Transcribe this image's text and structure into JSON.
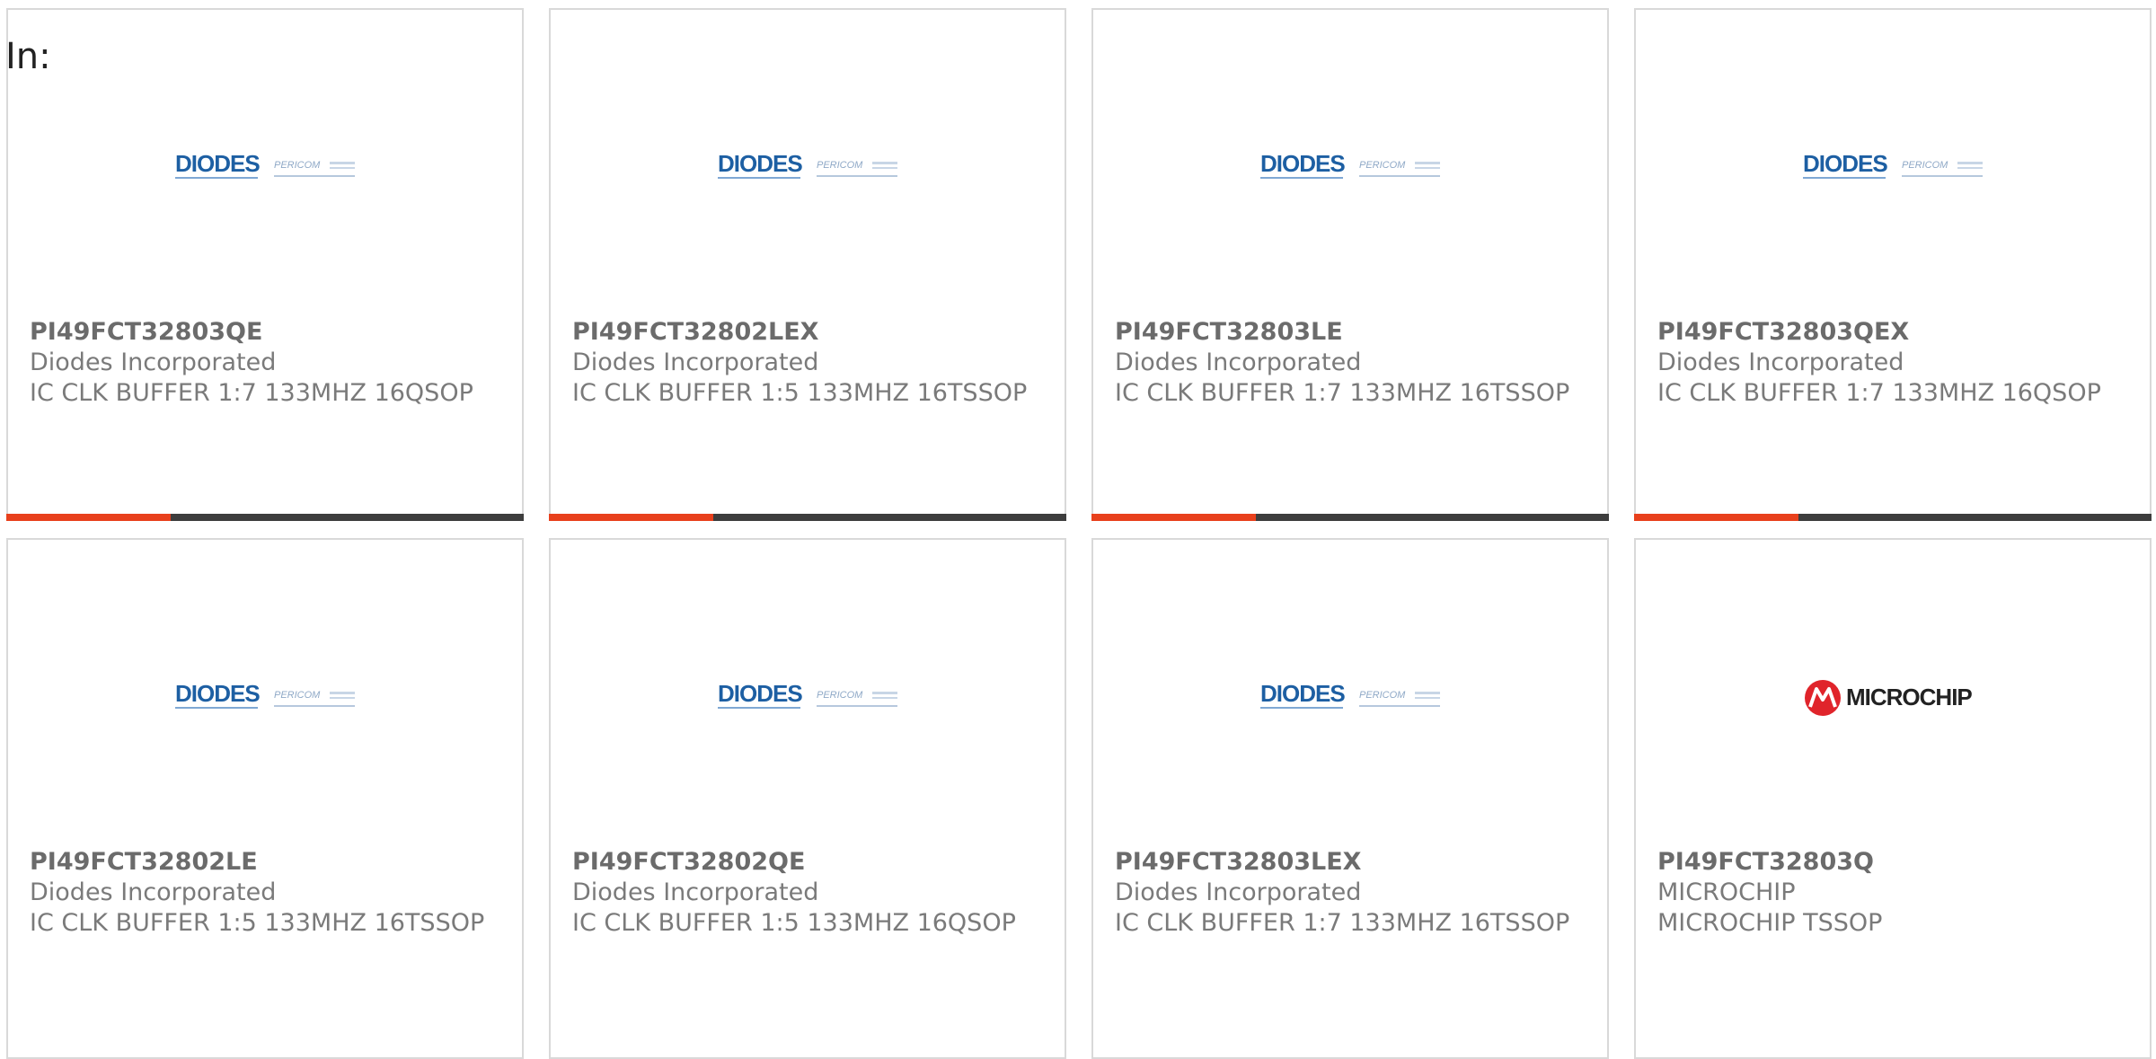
{
  "filter": {
    "label": "In:"
  },
  "colors": {
    "accent_orange": "#e8401c",
    "accent_dark": "#3d3d3d",
    "diodes_blue": "#1d5fa3",
    "microchip_red": "#e0242b"
  },
  "products": [
    {
      "part": "PI49FCT32803QE",
      "maker": "Diodes Incorporated",
      "desc": "IC CLK BUFFER 1:7 133MHZ 16QSOP",
      "logo": "diodes-pericom-logo",
      "logo_text": "DIODES",
      "logo_sub": "PERICOM"
    },
    {
      "part": "PI49FCT32802LEX",
      "maker": "Diodes Incorporated",
      "desc": "IC CLK BUFFER 1:5 133MHZ 16TSSOP",
      "logo": "diodes-pericom-logo",
      "logo_text": "DIODES",
      "logo_sub": "PERICOM"
    },
    {
      "part": "PI49FCT32803LE",
      "maker": "Diodes Incorporated",
      "desc": "IC CLK BUFFER 1:7 133MHZ 16TSSOP",
      "logo": "diodes-pericom-logo",
      "logo_text": "DIODES",
      "logo_sub": "PERICOM"
    },
    {
      "part": "PI49FCT32803QEX",
      "maker": "Diodes Incorporated",
      "desc": "IC CLK BUFFER 1:7 133MHZ 16QSOP",
      "logo": "diodes-pericom-logo",
      "logo_text": "DIODES",
      "logo_sub": "PERICOM"
    },
    {
      "part": "PI49FCT32802LE",
      "maker": "Diodes Incorporated",
      "desc": "IC CLK BUFFER 1:5 133MHZ 16TSSOP",
      "logo": "diodes-pericom-logo",
      "logo_text": "DIODES",
      "logo_sub": "PERICOM"
    },
    {
      "part": "PI49FCT32802QE",
      "maker": "Diodes Incorporated",
      "desc": "IC CLK BUFFER 1:5 133MHZ 16QSOP",
      "logo": "diodes-pericom-logo",
      "logo_text": "DIODES",
      "logo_sub": "PERICOM"
    },
    {
      "part": "PI49FCT32803LEX",
      "maker": "Diodes Incorporated",
      "desc": "IC CLK BUFFER 1:7 133MHZ 16TSSOP",
      "logo": "diodes-pericom-logo",
      "logo_text": "DIODES",
      "logo_sub": "PERICOM"
    },
    {
      "part": "PI49FCT32803Q",
      "maker": "MICROCHIP",
      "desc": "MICROCHIP TSSOP",
      "logo": "microchip-logo",
      "logo_text": "MICROCHIP"
    }
  ]
}
